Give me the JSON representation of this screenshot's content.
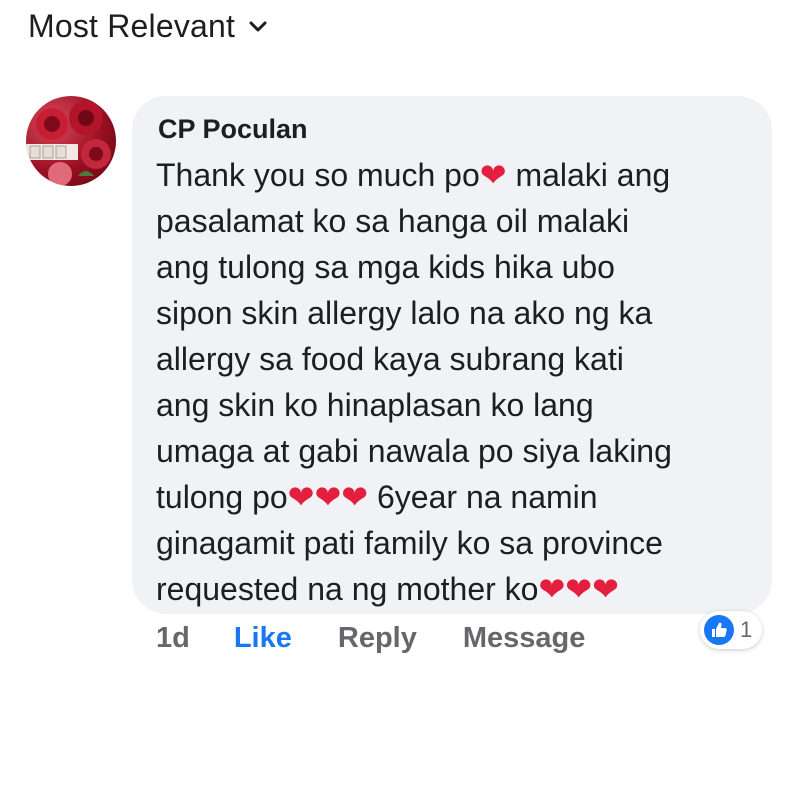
{
  "sort": {
    "label": "Most Relevant"
  },
  "comment": {
    "author": "CP Poculan",
    "lines": [
      "Thank you so much po",
      "❤",
      " malaki ang",
      "pasalamat  ko sa hanga oil malaki",
      "ang tulong sa mga kids hika ubo",
      "sipon skin allergy lalo na ako ng ka",
      "allergy sa food  kaya subrang kati",
      "ang skin  ko hinaplasan ko lang",
      "umaga at gabi  nawala po siya laking",
      "tulong po",
      "❤❤❤",
      " 6year na namin",
      "ginagamit pati family  ko sa province",
      "requested na ng mother ko",
      "❤❤❤"
    ],
    "time": "1d",
    "actions": {
      "like": "Like",
      "reply": "Reply",
      "message": "Message"
    },
    "reaction_count": "1"
  },
  "colors": {
    "accent": "#1877f2",
    "heart": "#e41e3f",
    "bubble": "#f0f2f5"
  },
  "icons": {
    "sort": "chevron-down-icon",
    "reaction": "like-thumb-icon"
  }
}
